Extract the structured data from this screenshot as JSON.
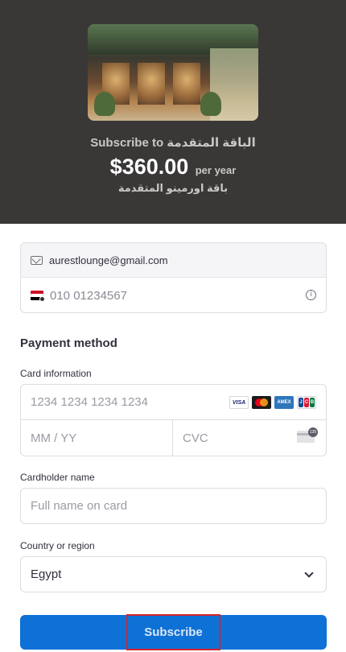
{
  "header": {
    "subscribe_title": "Subscribe to الباقة المتقدمة",
    "price": "$360.00",
    "period": "per year",
    "product_description": "باقة اورمينو المتقدمة",
    "background_color": "#3a3737"
  },
  "contact": {
    "email": "aurestlounge@gmail.com",
    "phone_placeholder": "010 01234567",
    "country_flag": "egypt-flag-icon"
  },
  "payment": {
    "section_title": "Payment method",
    "card_label": "Card information",
    "card_number_placeholder": "1234 1234 1234 1234",
    "expiry_placeholder": "MM / YY",
    "cvc_placeholder": "CVC",
    "cvc_badge": "135",
    "brands": {
      "visa": "VISA",
      "amex": "AMEX",
      "jcb": [
        "J",
        "C",
        "B"
      ]
    },
    "cardholder_label": "Cardholder name",
    "cardholder_placeholder": "Full name on card",
    "country_label": "Country or region",
    "country_value": "Egypt"
  },
  "actions": {
    "subscribe_label": "Subscribe",
    "accent_color": "#0e71d6"
  }
}
